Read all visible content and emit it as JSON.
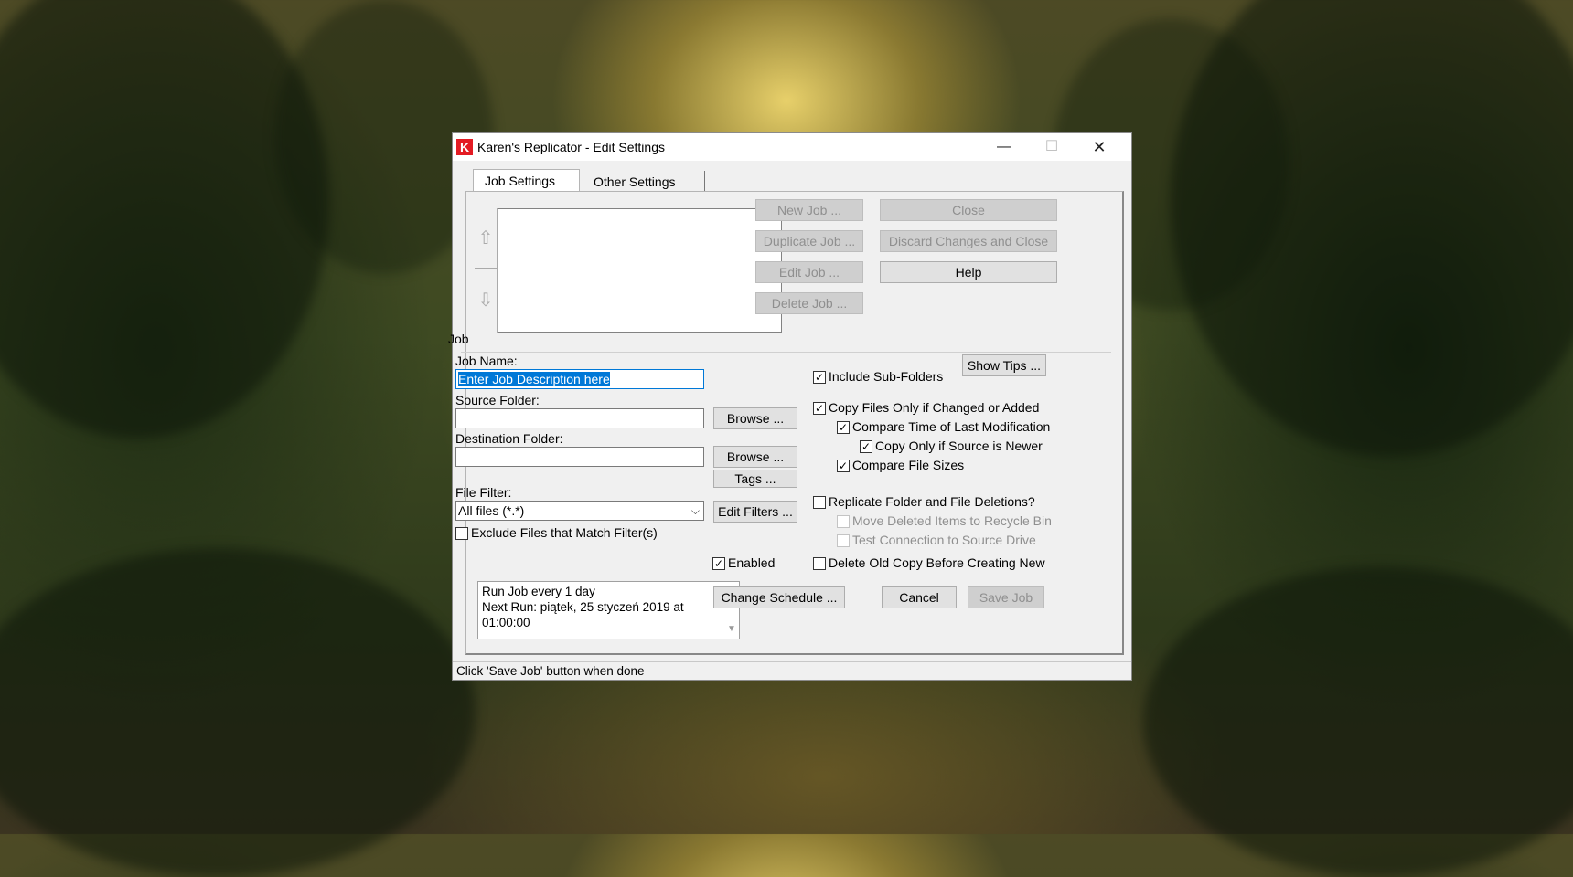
{
  "window": {
    "title": "Karen's Replicator - Edit Settings",
    "icon_letter": "K",
    "controls": {
      "minimize": "—",
      "maximize": "☐",
      "close": "✕"
    }
  },
  "tabs": [
    {
      "label": "Job Settings",
      "active": true
    },
    {
      "label": "Other Settings",
      "active": false
    }
  ],
  "job_list": {
    "up_arrow": "⇧",
    "down_arrow": "⇩",
    "items": []
  },
  "job_buttons": {
    "new_job": "New Job ...",
    "duplicate_job": "Duplicate Job ...",
    "edit_job": "Edit Job ...",
    "delete_job": "Delete Job ..."
  },
  "main_buttons": {
    "close": "Close",
    "discard": "Discard Changes and Close",
    "help": "Help"
  },
  "job_group": {
    "label": "Job",
    "job_name_label": "Job Name:",
    "job_name_value": "Enter Job Description here",
    "source_folder_label": "Source Folder:",
    "source_folder_value": "",
    "destination_folder_label": "Destination Folder:",
    "destination_folder_value": "",
    "browse_label": "Browse ...",
    "tags_label": "Tags ...",
    "file_filter_label": "File Filter:",
    "file_filter_value": "All files (*.*)",
    "edit_filters_label": "Edit Filters ...",
    "exclude_label": "Exclude Files that Match Filter(s)",
    "schedule_line1": "Run Job every 1 day",
    "schedule_line2": "Next Run: piątek, 25 styczeń 2019 at",
    "schedule_line3": "01:00:00",
    "enabled_label": "Enabled",
    "change_schedule_label": "Change Schedule ...",
    "show_tips_label": "Show Tips ...",
    "cancel_label": "Cancel",
    "save_job_label": "Save Job"
  },
  "options": {
    "include_subfolders": "Include Sub-Folders",
    "copy_only_changed": "Copy Files Only if Changed or Added",
    "compare_time": "Compare Time of Last Modification",
    "copy_only_newer": "Copy Only if Source is Newer",
    "compare_sizes": "Compare File Sizes",
    "replicate_deletions": "Replicate Folder and File Deletions?",
    "move_recycle": "Move Deleted Items to Recycle Bin",
    "test_connection": "Test Connection to Source Drive",
    "delete_old_copy": "Delete Old Copy Before Creating New",
    "check_mark": "✓"
  },
  "status": "Click 'Save Job' button when done"
}
